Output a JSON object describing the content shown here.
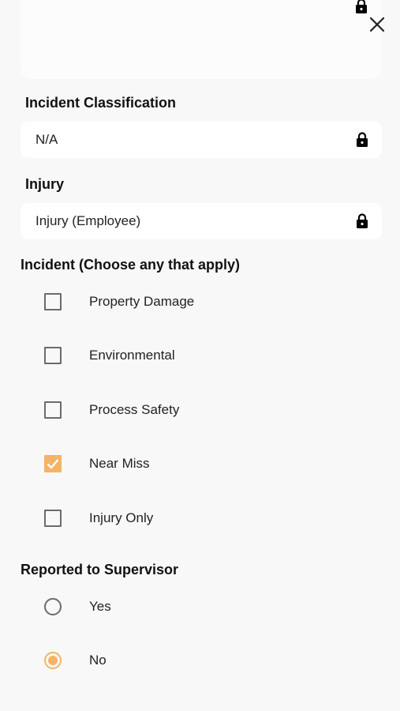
{
  "colors": {
    "accent": "#f5b364",
    "background": "#f8f8f8",
    "field_background": "#ffffff",
    "unchecked_border": "#6b6b6b"
  },
  "top_card": {
    "lock_icon": "lock-icon"
  },
  "close_icon": "close-icon",
  "classification": {
    "label": "Incident Classification",
    "value": "N/A",
    "icon": "lock-icon"
  },
  "injury": {
    "label": "Injury",
    "value": "Injury (Employee)",
    "icon": "lock-icon"
  },
  "incident": {
    "label": "Incident (Choose any that apply)",
    "options": [
      {
        "label": "Property Damage",
        "checked": false
      },
      {
        "label": "Environmental",
        "checked": false
      },
      {
        "label": "Process Safety",
        "checked": false
      },
      {
        "label": "Near Miss",
        "checked": true
      },
      {
        "label": "Injury Only",
        "checked": false
      }
    ]
  },
  "reported": {
    "label": "Reported to Supervisor",
    "options": [
      {
        "label": "Yes",
        "selected": false
      },
      {
        "label": "No",
        "selected": true
      }
    ]
  }
}
